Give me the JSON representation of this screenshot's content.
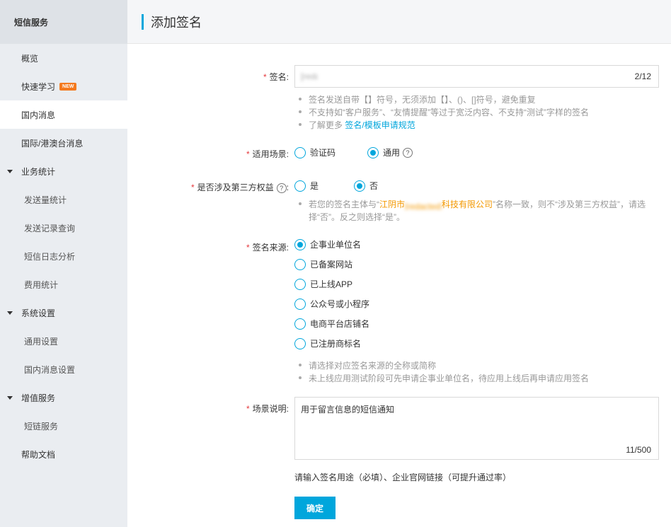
{
  "sidebar": {
    "title": "短信服务",
    "items": [
      {
        "label": "概览"
      },
      {
        "label": "快速学习",
        "badge": "NEW"
      },
      {
        "label": "国内消息",
        "active": true
      },
      {
        "label": "国际/港澳台消息"
      }
    ],
    "groups": [
      {
        "label": "业务统计",
        "children": [
          "发送量统计",
          "发送记录查询",
          "短信日志分析",
          "费用统计"
        ]
      },
      {
        "label": "系统设置",
        "children": [
          "通用设置",
          "国内消息设置"
        ]
      },
      {
        "label": "增值服务",
        "children": [
          "短链服务"
        ]
      }
    ],
    "footer_item": "帮助文档"
  },
  "header": {
    "title": "添加签名"
  },
  "form": {
    "signature": {
      "label": "签名:",
      "value": "[redacted]",
      "counter": "2/12",
      "hints": [
        "签名发送自带【】符号，无须添加【】、()、[]符号，避免重复",
        "不支持如“客户服务”、“友情提醒”等过于宽泛内容、不支持“测试”字样的签名"
      ],
      "hint_more_prefix": "了解更多",
      "hint_more_link": "签名/模板申请规范"
    },
    "scene": {
      "label": "适用场景:",
      "options": [
        "验证码",
        "通用"
      ],
      "selected": "通用"
    },
    "third_party": {
      "label": "是否涉及第三方权益",
      "label_suffix": ":",
      "options": [
        "是",
        "否"
      ],
      "selected": "否",
      "hint_prefix": "若您的签名主体与“",
      "hint_company_a": "江阴市",
      "hint_company_blur": "[redacted]",
      "hint_company_b": "科技有限公司",
      "hint_suffix": "”名称一致，则不“涉及第三方权益”，请选",
      "hint_line2": "择“否”。反之则选择“是”。"
    },
    "source": {
      "label": "签名来源:",
      "options": [
        "企事业单位名",
        "已备案网站",
        "已上线APP",
        "公众号或小程序",
        "电商平台店铺名",
        "已注册商标名"
      ],
      "selected": "企事业单位名",
      "hints": [
        "请选择对应签名来源的全称或简称",
        "未上线应用测试阶段可先申请企事业单位名，待应用上线后再申请应用签名"
      ]
    },
    "description": {
      "label": "场景说明:",
      "value": "用于留言信息的短信通知",
      "counter": "11/500",
      "note": "请输入签名用途（必填）、企业官网链接（可提升通过率）"
    },
    "submit_label": "确定"
  },
  "colors": {
    "accent": "#00a6dc",
    "required": "#e5393d",
    "badge": "#f47a1f",
    "highlight": "#f39800"
  }
}
